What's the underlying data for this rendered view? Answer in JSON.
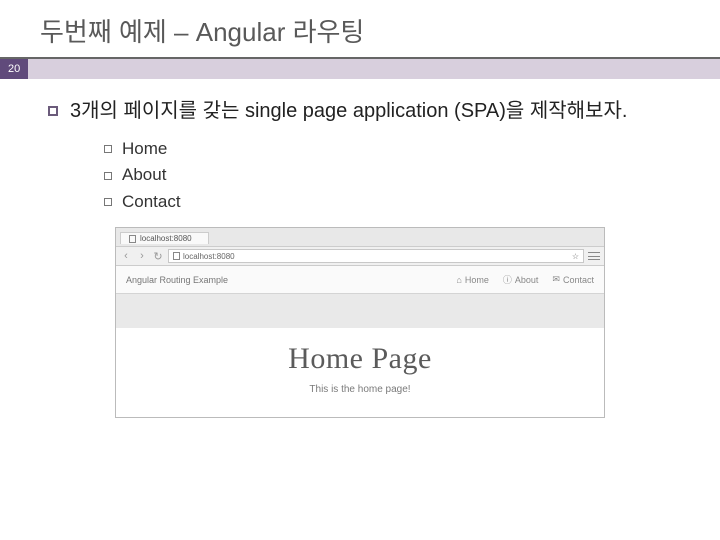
{
  "slide": {
    "title": "두번째 예제 – Angular 라우팅",
    "page_number": "20"
  },
  "bullets": {
    "level1": "3개의 페이지를 갖는 single page application (SPA)을 제작해보자.",
    "level2": [
      "Home",
      "About",
      "Contact"
    ]
  },
  "browser": {
    "tab_title": "localhost:8080",
    "url": "localhost:8080",
    "star": "☆",
    "back": "‹",
    "forward": "›",
    "reload": "↻"
  },
  "app": {
    "brand": "Angular Routing Example",
    "nav": [
      {
        "icon": "⌂",
        "label": "Home"
      },
      {
        "icon": "ⓘ",
        "label": "About"
      },
      {
        "icon": "✉",
        "label": "Contact"
      }
    ],
    "heading": "Home Page",
    "subtext": "This is the home page!"
  }
}
